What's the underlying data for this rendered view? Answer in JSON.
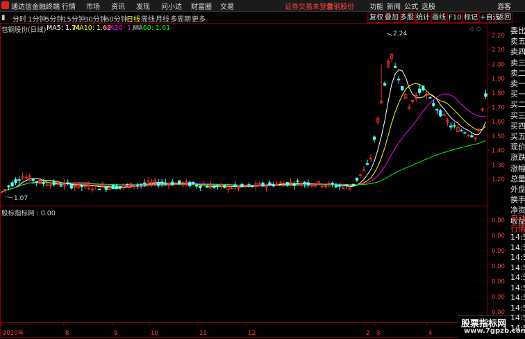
{
  "app": {
    "title": "通达信金融终端",
    "menu": [
      "行情",
      "市场",
      "资讯",
      "发现",
      "问小达",
      "财富圈",
      "交易"
    ],
    "login_warning": "证券交易未登录",
    "stock_name": "包钢股份",
    "right_menu": [
      "功能",
      "新闻",
      "公式",
      "选股",
      "游客"
    ]
  },
  "toolbar": {
    "periods": [
      "分时",
      "1分钟",
      "5分钟",
      "15分钟",
      "30分钟",
      "60分钟",
      "日线",
      "周线",
      "月线",
      "多周期",
      "更多"
    ],
    "active_period": "日线",
    "tools": [
      "复权",
      "叠加",
      "多股",
      "统计",
      "画线",
      "F10",
      "标记",
      "+自选",
      "返回"
    ]
  },
  "main_chart": {
    "legend_title": "包钢股份(日线)",
    "ma5": "MA5: 1.74",
    "ma10": "MA10: 1.62",
    "ma20": "MA20: 1.60",
    "ma60": "MA60: 1.61",
    "high_label": "2.24",
    "low_label": "1.07",
    "colors": {
      "ma5": "#ffffff",
      "ma10": "#ffff00",
      "ma20": "#ff00ff",
      "ma60": "#00ff00",
      "up": "#ff3232",
      "down": "#54ffff"
    },
    "y_ticks": [
      "2.20",
      "2.10",
      "2.00",
      "1.90",
      "1.80",
      "1.70",
      "1.60",
      "1.50",
      "1.40",
      "1.30",
      "1.20"
    ]
  },
  "sub_chart": {
    "legend": "股标指标网 : 0.00",
    "y_ticks": [
      "0.00",
      "0.00",
      "0.00",
      "0.00",
      "0.00",
      "0.00",
      "0.00"
    ]
  },
  "x_axis": [
    "2020年",
    "8",
    "9",
    "10",
    "11",
    "12",
    "2",
    "3",
    "4"
  ],
  "right_panel": [
    "委比",
    "卖五",
    "卖四",
    "卖三",
    "卖二",
    "卖一",
    "买一",
    "买二",
    "买三",
    "买四",
    "买五",
    "现价",
    "涨跌",
    "涨幅",
    "总量",
    "外盘",
    "换手",
    "净资",
    "收益",
    "自动",
    "行情",
    "14:5",
    "14:5",
    "14:5",
    "14:5",
    "14:5",
    "14:5",
    "14:5",
    "14:5",
    "14:5",
    "14:5"
  ],
  "watermark": {
    "line1": "股票指标网",
    "line2": "www.7gpzb.com"
  }
}
